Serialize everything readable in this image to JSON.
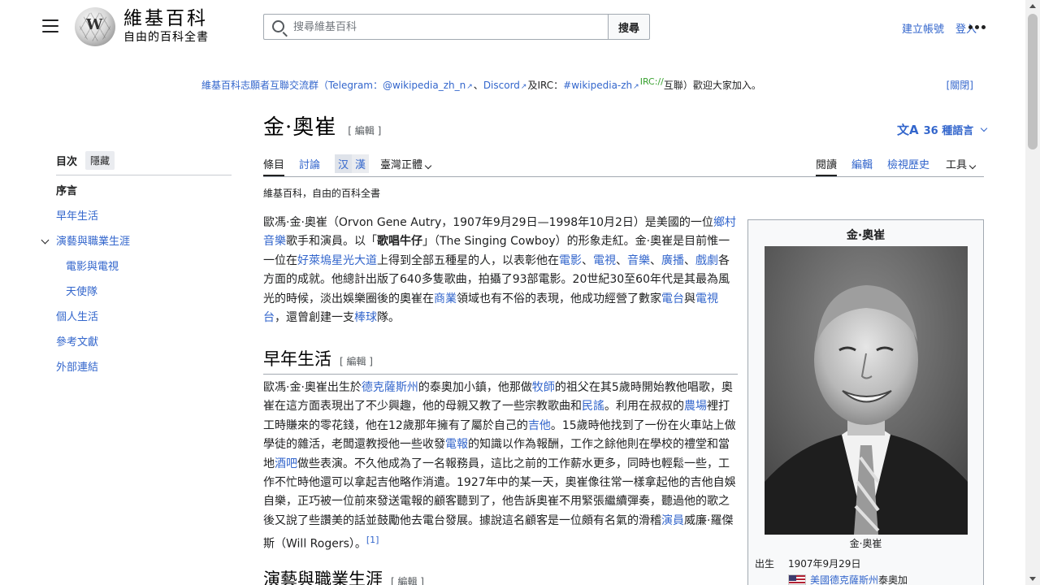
{
  "header": {
    "wordmark_title": "維基百科",
    "wordmark_tagline": "自由的百科全書",
    "search_placeholder": "搜尋維基百科",
    "search_button": "搜尋",
    "create_account": "建立帳號",
    "login": "登入"
  },
  "sitenotice": {
    "part1": "維基百科志願者互聯交流群（Telegram：",
    "telegram": "@wikipedia_zh_n",
    "sep1": "、",
    "discord": "Discord",
    "sep2": "及IRC：",
    "irc": "#wikipedia-zh",
    "irc_sup": "IRC://",
    "part2": "互聯）歡迎大家加入。",
    "close": "[關閉]"
  },
  "toc": {
    "title": "目次",
    "hide": "隱藏",
    "items": [
      {
        "label": "序言"
      },
      {
        "label": "早年生活"
      },
      {
        "label": "演藝與職業生涯"
      },
      {
        "label": "電影與電視"
      },
      {
        "label": "天使隊"
      },
      {
        "label": "個人生活"
      },
      {
        "label": "參考文獻"
      },
      {
        "label": "外部連結"
      }
    ]
  },
  "article": {
    "title": "金·奧崔",
    "edit": "[ 編輯 ]",
    "languages": "36 種語言",
    "tabs": {
      "article": "條目",
      "talk": "討論",
      "variant_simplified": "汉",
      "variant_traditional": "漢",
      "variant_select": "臺灣正體",
      "read": "閱讀",
      "edit": "編輯",
      "history": "檢視歷史",
      "tools": "工具"
    },
    "tagline": "維基百科，自由的百科全書",
    "section_early": "早年生活",
    "section_career": "演藝與職業生涯",
    "section_edit": "[ 編輯 ]",
    "ref1": "[1]"
  },
  "infobox": {
    "title": "金·奧崔",
    "caption": "金·奧崔",
    "born_label": "出生",
    "born_date": "1907年9月29日",
    "born_place_link": "美國德克薩斯州",
    "born_place_rest": "泰奧加"
  },
  "colors": {
    "link": "#3366cc",
    "text": "#202122",
    "border": "#a2a9b1"
  }
}
